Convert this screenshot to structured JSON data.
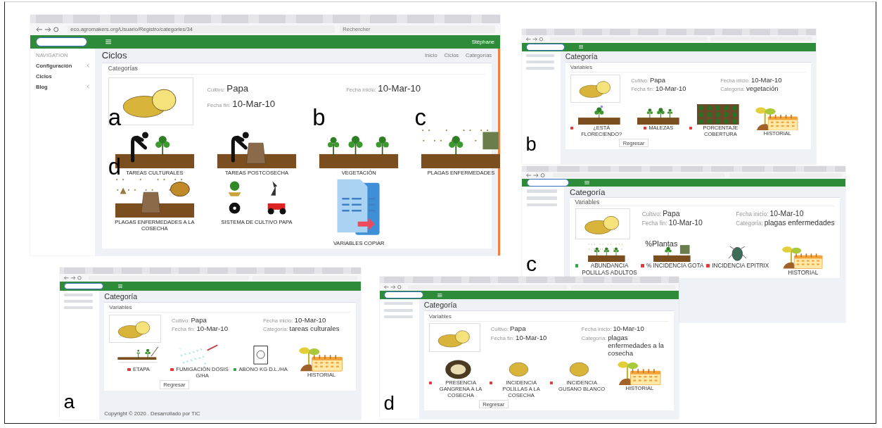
{
  "main": {
    "url": "eco.agromakers.org/Usuario/Registro/categories/34",
    "search": "Rechercher",
    "user": "Stéphane",
    "nav_heading": "NAVIGATION",
    "nav": [
      {
        "label": "Configuración",
        "expandable": true
      },
      {
        "label": "Ciclos",
        "expandable": false
      },
      {
        "label": "Blog",
        "expandable": true
      }
    ],
    "title": "Ciclos",
    "breadcrumb": [
      "Inicio",
      "Ciclos",
      "Categorías"
    ],
    "card_title": "Categorías",
    "fields": [
      {
        "label": "Cultivo:",
        "value": "Papa"
      },
      {
        "label": "Fecha inicio:",
        "value": "10-Mar-10"
      },
      {
        "label": "Fecha fin:",
        "value": "10-Mar-10"
      }
    ],
    "tiles": [
      {
        "label": "TAREAS CULTURALES",
        "kind": "worker",
        "figure_letter": "a"
      },
      {
        "label": "TAREAS POSTCOSECHA",
        "kind": "worker-sack"
      },
      {
        "label": "VEGETACIÓN",
        "kind": "plants",
        "figure_letter": "b"
      },
      {
        "label": "PLAGAS ENFERMEDADES",
        "kind": "pests",
        "figure_letter": "c"
      },
      {
        "label": "PLAGAS ENFERMEDADES A LA COSECHA",
        "kind": "sack-pests",
        "figure_letter": "d"
      },
      {
        "label": "SISTEMA DE CULTIVO PAPA",
        "kind": "system"
      },
      {
        "label": "VARIABLES COPIAR",
        "kind": "copy"
      }
    ]
  },
  "panels": [
    {
      "figure_letter": "b",
      "title": "Categoría",
      "card_title": "Variables",
      "fields": [
        {
          "label": "Cultivo:",
          "value": "Papa"
        },
        {
          "label": "Fecha inicio:",
          "value": "10-Mar-10"
        },
        {
          "label": "Fecha fin:",
          "value": "10-Mar-10"
        },
        {
          "label": "Categoría:",
          "value": "vegetación"
        }
      ],
      "variables": [
        {
          "label": "¿ESTÁ FLORECIENDO?",
          "color": "#e53935",
          "kind": "flowering"
        },
        {
          "label": "MALEZAS",
          "color": "#e53935",
          "kind": "weeds"
        },
        {
          "label": "PORCENTAJE COBERTURA",
          "color": "#e53935",
          "kind": "coverage"
        }
      ],
      "history": "HISTORIAL",
      "back": "Regresar"
    },
    {
      "figure_letter": "c",
      "title": "Categoría",
      "card_title": "Variables",
      "fields": [
        {
          "label": "Cultivo:",
          "value": "Papa"
        },
        {
          "label": "Fecha inicio:",
          "value": "10-Mar-10"
        },
        {
          "label": "Fecha fin:",
          "value": "10-Mar-10"
        },
        {
          "label": "Categoría:",
          "value": "plagas enfermedades"
        }
      ],
      "variables": [
        {
          "label": "ABUNDANCIA POLILLAS ADULTOS",
          "color": "#2eaa4a",
          "kind": "moths"
        },
        {
          "label": "% INCIDENCIA GOTA",
          "color": "#e53935",
          "kind": "disease",
          "image_text": "%Plantas"
        },
        {
          "label": "INCIDENCIA EPITRIX",
          "color": "#e53935",
          "kind": "beetle"
        }
      ],
      "history": "HISTORIAL"
    },
    {
      "figure_letter": "a",
      "title": "Categoría",
      "card_title": "Variables",
      "fields": [
        {
          "label": "Cultivo:",
          "value": "Papa"
        },
        {
          "label": "Fecha inicio:",
          "value": "10-Mar-10"
        },
        {
          "label": "Fecha fin:",
          "value": "10-Mar-10"
        },
        {
          "label": "Categoría:",
          "value": "tareas culturales"
        }
      ],
      "variables": [
        {
          "label": "ETAPA",
          "color": "#e53935",
          "kind": "stages"
        },
        {
          "label": "FUMIGACIÓN DOSIS G/HA",
          "color": "#e53935",
          "kind": "spray"
        },
        {
          "label": "ABONO KG D.L./HA",
          "color": "#2eaa4a",
          "kind": "bag"
        }
      ],
      "history": "HISTORIAL",
      "back": "Regresar",
      "footer": "Copyright © 2020 . Desarrollado por TIC"
    },
    {
      "figure_letter": "d",
      "title": "Categoría",
      "card_title": "Variables",
      "fields": [
        {
          "label": "Cultivo:",
          "value": "Papa"
        },
        {
          "label": "Fecha inicio:",
          "value": "10-Mar-10"
        },
        {
          "label": "Fecha fin:",
          "value": "10-Mar-10"
        },
        {
          "label": "Categoría:",
          "value": "plagas enfermedades a la cosecha"
        }
      ],
      "variables": [
        {
          "label": "PRESENCIA GANGRENA A LA COSECHA",
          "color": "#e53935",
          "kind": "rotten"
        },
        {
          "label": "INCIDENCIA POLILLAS A LA COSECHA",
          "color": "#e53935",
          "kind": "tuber"
        },
        {
          "label": "INCIDENCIA GUSANO BLANCO",
          "color": "#e53935",
          "kind": "tuber"
        }
      ],
      "history": "HISTORIAL",
      "back": "Regresar"
    }
  ]
}
